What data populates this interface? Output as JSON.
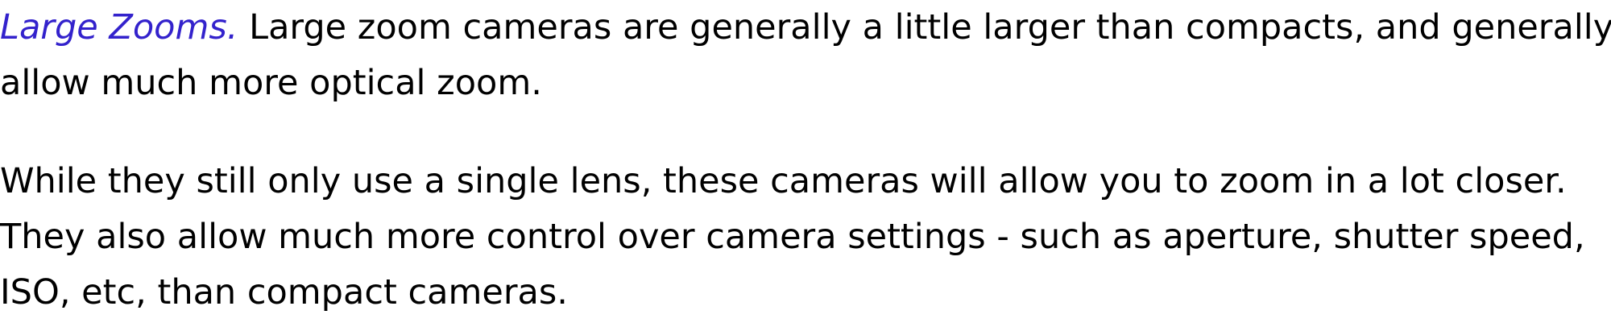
{
  "article": {
    "para1": {
      "term": "Large Zooms",
      "term_color": "#3322cc",
      "term_punct": ".",
      "line1_rest": " Large zoom cameras are generally a little larger than compacts, and generally",
      "line2": "allow much more optical zoom."
    },
    "para2": {
      "line1": "While they still only use a single lens, these cameras will allow you to zoom in a lot closer.",
      "line2": "They also allow much more control over camera settings - such as aperture, shutter speed,",
      "line3": "ISO, etc, than compact cameras."
    }
  }
}
